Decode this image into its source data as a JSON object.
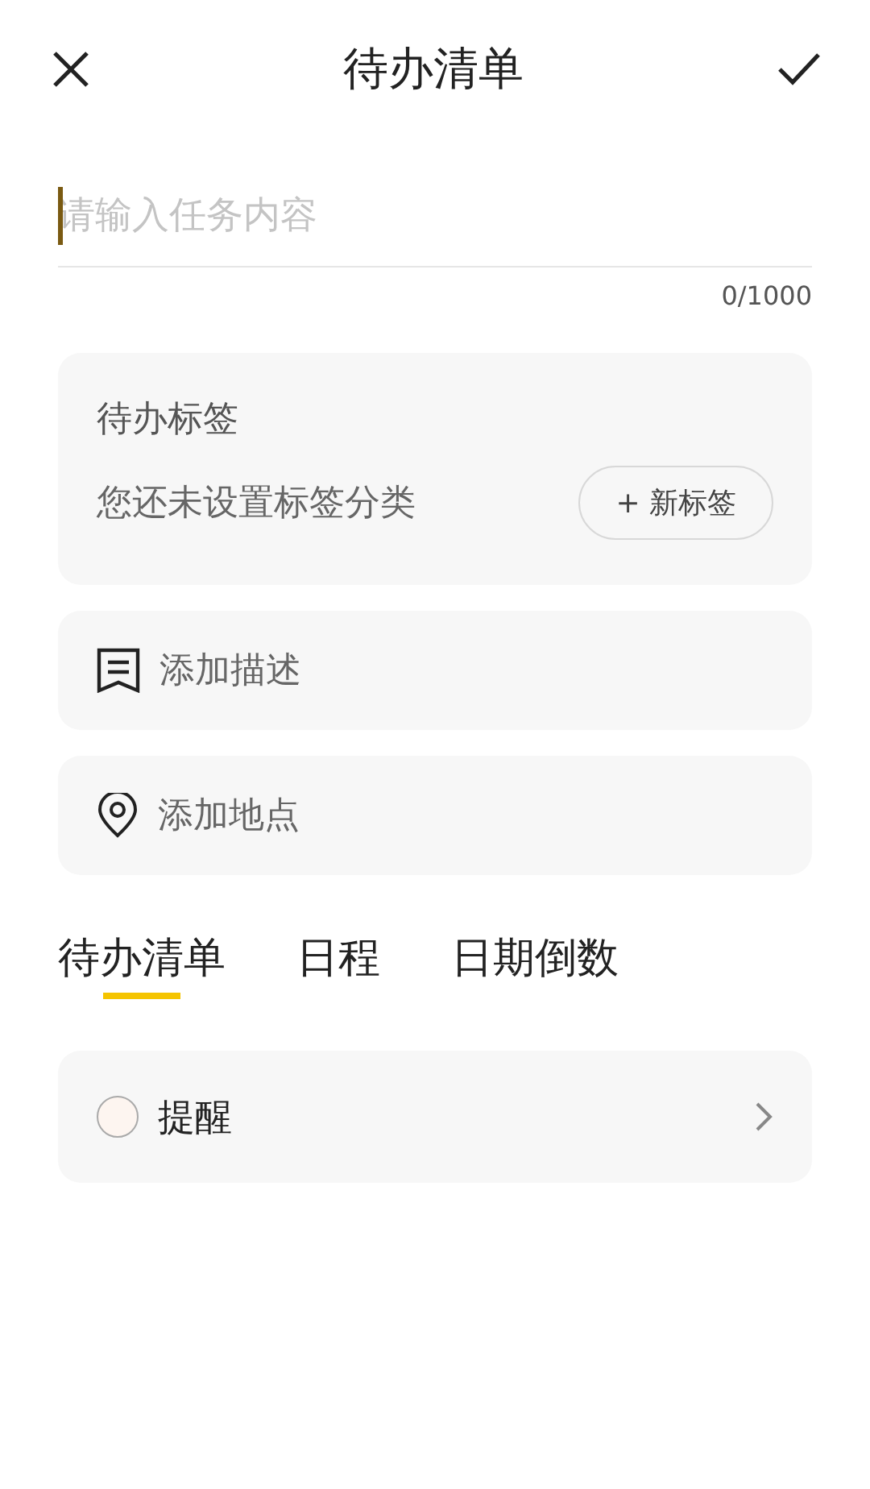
{
  "header": {
    "title": "待办清单"
  },
  "task_input": {
    "placeholder": "请输入任务内容",
    "focused": true,
    "counter": "0/1000"
  },
  "tag_card": {
    "title": "待办标签",
    "empty_text": "您还未设置标签分类",
    "button": "+ 新标签"
  },
  "rows": [
    {
      "kind": "description",
      "label": "添加描述"
    },
    {
      "kind": "location",
      "label": "添加地点"
    }
  ],
  "tabs": [
    {
      "label": "待办清单",
      "selected": true
    },
    {
      "label": "日程",
      "selected": false
    },
    {
      "label": "日期倒数",
      "selected": false
    }
  ],
  "reminder": {
    "label": "提醒",
    "checked": false
  }
}
